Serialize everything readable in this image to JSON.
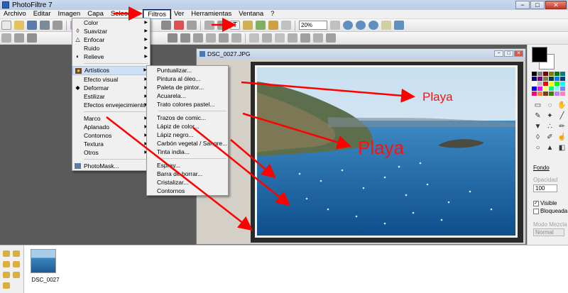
{
  "window": {
    "title": "PhotoFiltre 7",
    "minimize": "−",
    "maximize": "□",
    "close": "✕"
  },
  "menubar": [
    "Archivo",
    "Editar",
    "Imagen",
    "Capa",
    "Selección",
    "Filtros",
    "Ver",
    "Herramientas",
    "Ventana",
    "?"
  ],
  "menubar_active": "Filtros",
  "toolbar": {
    "zoom": "20%"
  },
  "image_window": {
    "title": "DSC_0027.JPG"
  },
  "filtros_menu": {
    "group1": [
      "Color",
      "Suavizar",
      "Enfocar",
      "Ruido",
      "Relieve"
    ],
    "group2": [
      "Artísticos",
      "Efecto visual",
      "Deformar",
      "Estilizar",
      "Efectos envejecimiento"
    ],
    "group3": [
      "Marco",
      "Aplanado",
      "Contornos",
      "Textura",
      "Otros"
    ],
    "group4": [
      "PhotoMask..."
    ],
    "highlighted": "Artísticos"
  },
  "artisticos_submenu": {
    "group1": [
      "Puntualizar...",
      "Pintura al óleo...",
      "Paleta de pintor...",
      "Acuarela...",
      "Trato colores pastel..."
    ],
    "group2": [
      "Trazos de comic...",
      "Lápiz de color...",
      "Lápiz negro...",
      "Carbón vegetal / Sangre...",
      "Tinta india..."
    ],
    "group3": [
      "Espray...",
      "Barra de borrar...",
      "Cristalizar...",
      "Contornos"
    ]
  },
  "right_panel": {
    "fondo": "Fondo",
    "opacidad": "Opacidad",
    "opacidad_value": "100",
    "visible": "Visible",
    "bloqueada": "Bloqueada",
    "modo_mezcla": "Modo Mezcla",
    "modo_value": "Normal"
  },
  "palette": [
    "#000000",
    "#808080",
    "#800000",
    "#808000",
    "#008000",
    "#008080",
    "#000080",
    "#800080",
    "#808040",
    "#004040",
    "#0080ff",
    "#004080",
    "#ffffff",
    "#c0c0c0",
    "#ff0000",
    "#ffff00",
    "#00ff00",
    "#00ffff",
    "#0000ff",
    "#ff00ff",
    "#ffff80",
    "#00ff80",
    "#80ffff",
    "#8080ff",
    "#ff0080",
    "#ff8040",
    "#804000",
    "#408000",
    "#c080ff",
    "#ff80c0"
  ],
  "tools": [
    "select-icon",
    "lasso-icon",
    "hand-icon",
    "eyedropper-icon",
    "wand-icon",
    "line-icon",
    "fill-icon",
    "spray-icon",
    "brush-icon",
    "drop-icon",
    "pencil-icon",
    "smudge-icon",
    "blur-icon",
    "stamp-icon",
    "gradient-icon"
  ],
  "thumbnail": {
    "label": "DSC_0027"
  },
  "annotations": {
    "label_small": "Playa",
    "label_big": "Playa"
  }
}
